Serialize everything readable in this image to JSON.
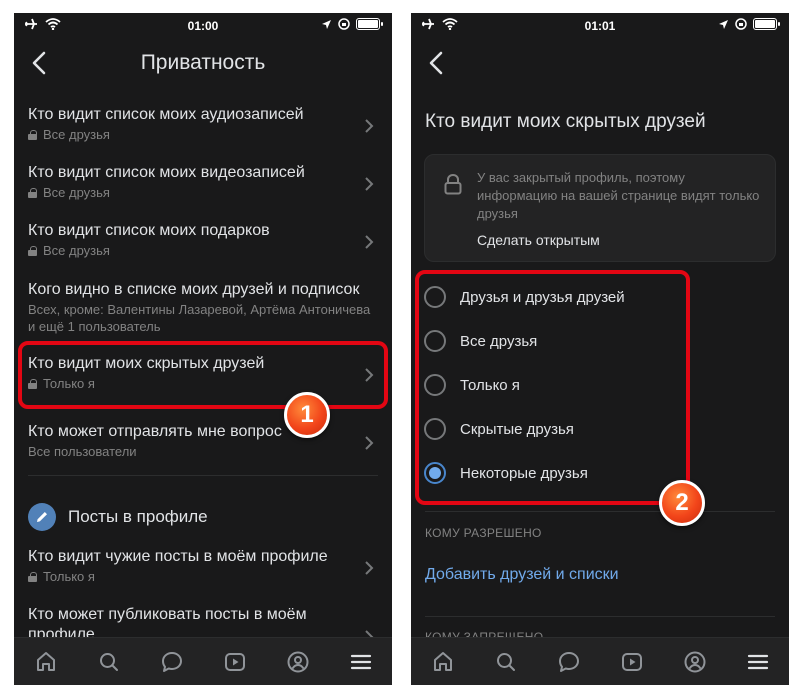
{
  "left_phone": {
    "status": {
      "time": "01:00"
    },
    "title": "Приватность",
    "items": [
      {
        "title": "Кто видит список моих аудиозаписей",
        "subtitle": "Все друзья",
        "locked": true
      },
      {
        "title": "Кто видит список моих видеозаписей",
        "subtitle": "Все друзья",
        "locked": true
      },
      {
        "title": "Кто видит список моих подарков",
        "subtitle": "Все друзья",
        "locked": true
      },
      {
        "title": "Кого видно в списке моих друзей и подписок",
        "subtitle": "Всех, кроме: Валентины Лазаревой, Артёма Антоничева и ещё 1 пользователь",
        "locked": false
      },
      {
        "title": "Кто видит моих скрытых друзей",
        "subtitle": "Только я",
        "locked": true
      },
      {
        "title": "Кто может отправлять мне вопрос",
        "subtitle": "Все пользователи",
        "locked": false
      }
    ],
    "section_title": "Посты в профиле",
    "section_items": [
      {
        "title": "Кто видит чужие посты в моём профиле",
        "subtitle": "Только я",
        "locked": true
      },
      {
        "title": "Кто может публиковать посты в моём",
        "subtitle": "профиле",
        "locked": false
      }
    ],
    "badge": "1"
  },
  "right_phone": {
    "status": {
      "time": "01:01"
    },
    "title": "Кто видит моих скрытых друзей",
    "info": {
      "text": "У вас закрытый профиль, поэтому информацию на вашей странице видят только друзья",
      "link": "Сделать открытым"
    },
    "options": [
      {
        "label": "Друзья и друзья друзей",
        "checked": false
      },
      {
        "label": "Все друзья",
        "checked": false
      },
      {
        "label": "Только я",
        "checked": false
      },
      {
        "label": "Скрытые друзья",
        "checked": false
      },
      {
        "label": "Некоторые друзья",
        "checked": true
      }
    ],
    "allowed_header": "КОМУ РАЗРЕШЕНО",
    "add_link": "Добавить друзей и списки",
    "denied_header": "КОМУ ЗАПРЕЩЕНО",
    "badge": "2"
  },
  "tabbar": [
    "home-icon",
    "search-icon",
    "messages-icon",
    "video-icon",
    "profile-icon",
    "menu-icon"
  ],
  "colors": {
    "background": "#19191a",
    "accent": "#71aaeb",
    "highlight": "#e30613",
    "badge": "#f2451a"
  }
}
